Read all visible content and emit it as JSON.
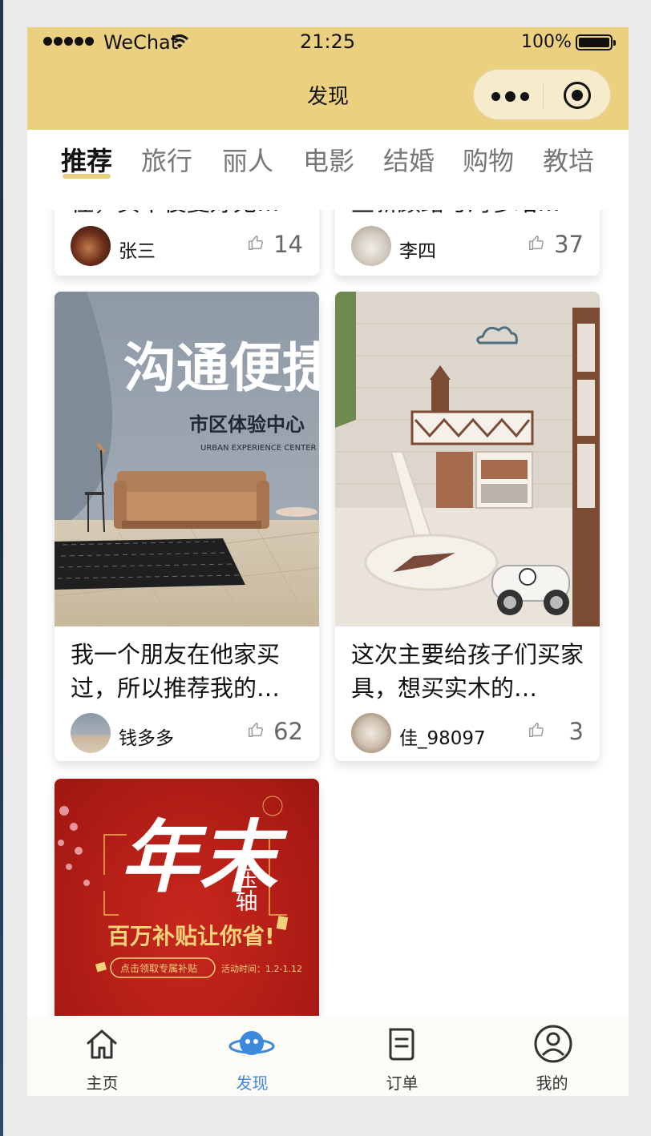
{
  "status_bar": {
    "carrier": "WeChat",
    "time": "21:25",
    "battery": "100%"
  },
  "nav_bar": {
    "title": "发现"
  },
  "category_tabs": [
    {
      "label": "推荐",
      "active": true
    },
    {
      "label": "旅行",
      "active": false
    },
    {
      "label": "丽人",
      "active": false
    },
    {
      "label": "电影",
      "active": false
    },
    {
      "label": "结婚",
      "active": false
    },
    {
      "label": "购物",
      "active": false
    },
    {
      "label": "教培",
      "active": false
    }
  ],
  "feed": {
    "partial_cards": [
      {
        "title_fragment": "住，买下俊复好无…",
        "author": "张三",
        "likes": "14"
      },
      {
        "title_fragment": "些新颜路与淘参站…",
        "author": "李四",
        "likes": "37"
      }
    ],
    "cards": [
      {
        "cover_text": {
          "headline": "沟通便捷",
          "sub": "市区体验中心",
          "sub_en": "URBAN EXPERIENCE CENTER"
        },
        "title": "我一个朋友在他家买过，所以推荐我的…",
        "author": "钱多多",
        "likes": "62"
      },
      {
        "title": "这次主要给孩子们买家具，想买实木的…",
        "author": "佳_98097",
        "likes": "3"
      },
      {
        "cover_text": {
          "headline": "年末",
          "side": "压轴",
          "banner": "百万补贴让你省!",
          "button": "点击领取专属补贴",
          "date": "活动时间：1.2-1.12"
        }
      }
    ]
  },
  "bottom_tabs": [
    {
      "label": "主页",
      "icon": "home-icon",
      "active": false
    },
    {
      "label": "发现",
      "icon": "discover-icon",
      "active": true
    },
    {
      "label": "订单",
      "icon": "order-icon",
      "active": false
    },
    {
      "label": "我的",
      "icon": "profile-icon",
      "active": false
    }
  ],
  "colors": {
    "header_bg": "#ead07f",
    "active_tab_blue": "#3d89dc"
  }
}
